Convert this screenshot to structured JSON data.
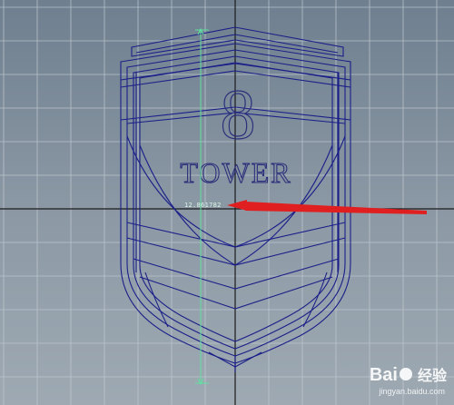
{
  "viewport": {
    "name": "3D wireframe viewport",
    "background_top": "#6f7f8f",
    "background_bottom": "#9ea9b2",
    "grid_color": "#c3cbd2",
    "wire_color": "#1b1f88"
  },
  "model": {
    "number_text": "8",
    "word_text": "TOWER"
  },
  "measurement": {
    "value": "12.861782",
    "line_color": "#5fe0a0",
    "pointer_arrow_color": "#e02020"
  },
  "watermark": {
    "brand_part1": "Bai",
    "brand_part2": "经验",
    "sub": "jingyan.baidu.com"
  }
}
